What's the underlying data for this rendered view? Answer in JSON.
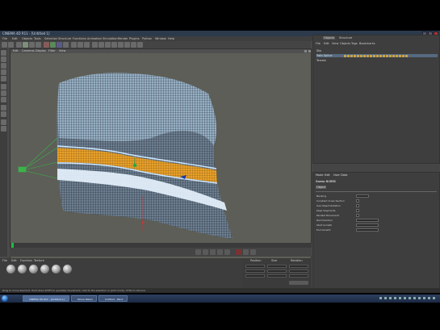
{
  "app": {
    "title": "CINEMA 4D R11 - [Untitled 1]",
    "menu": [
      "File",
      "Edit",
      "Objects",
      "Tools",
      "Selection",
      "Structure",
      "Functions",
      "Animation",
      "Simulation",
      "Render",
      "Plugins",
      "Python",
      "Window",
      "Help"
    ]
  },
  "viewport": {
    "menu": [
      "Edit",
      "Cameras",
      "Display",
      "Filter",
      "View"
    ]
  },
  "materials": {
    "menu": [
      "File",
      "Edit",
      "Function",
      "Texture"
    ],
    "count": 6
  },
  "coordinates": {
    "headers": [
      "Position",
      "Size",
      "Rotation"
    ]
  },
  "object_manager": {
    "tabs": [
      "Objects",
      "Structure"
    ],
    "menu": [
      "File",
      "Edit",
      "View",
      "Objects",
      "Tags",
      "Bookmarks"
    ],
    "objects": [
      "Sky",
      "Path Spline",
      "Terrain"
    ]
  },
  "attributes": {
    "menu": [
      "Mode",
      "Edit",
      "User Data"
    ],
    "section": "Sweep NURBS",
    "tab": "Object",
    "labels": [
      "Banking",
      "Constant Cross Section",
      "Use Object Rotation",
      "Keep Segments",
      "Parallel Movement",
      "Rail Direction",
      "Start Growth",
      "End Growth"
    ]
  },
  "status": {
    "text": "Drag to move element. Hold down SHIFT to quantize movement / add to the selection in point mode, CTRL to remove."
  },
  "taskbar": {
    "items": [
      "CINEMA 4D R11 - [Untitled 1]",
      "Movie Maker",
      "Untitled - Paint"
    ]
  },
  "colors": {
    "road": "#e8a12a",
    "mesh": "#b7dcff",
    "viewport_bg": "#5d5e57",
    "accent": "#22aa44"
  }
}
